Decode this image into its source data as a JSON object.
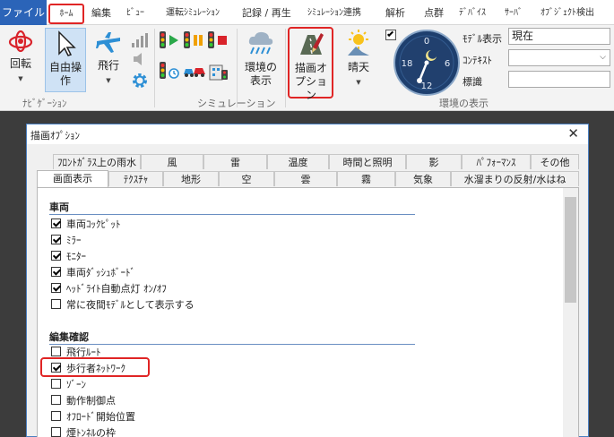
{
  "tabs": {
    "file": "ファイル",
    "home": "ﾎｰﾑ",
    "edit": "編集",
    "view": "ﾋﾞｭｰ",
    "driving_sim": "運転ｼﾐｭﾚｰｼｮﾝ",
    "record_play": "記録 / 再生",
    "sim_link": "ｼﾐｭﾚｰｼｮﾝ連携",
    "analysis": "解析",
    "point_cloud": "点群",
    "device": "ﾃﾞﾊﾞｲｽ",
    "server": "ｻｰﾊﾞ",
    "object_detect": "ｵﾌﾞｼﾞｪｸﾄ検出"
  },
  "ribbon": {
    "rotate": "回転",
    "free_op_1": "自由操",
    "free_op_2": "作",
    "fly": "飛行",
    "env_display_1": "環境の",
    "env_display_2": "表示",
    "draw_opt_1": "描画オ",
    "draw_opt_2": "プション",
    "fine": "晴天",
    "group_nav": "ﾅﾋﾞｹﾞｰｼｮﾝ",
    "group_sim": "シミュレーション",
    "group_env": "環境の表示",
    "model_display_label": "ﾓﾃﾞﾙ表示",
    "model_display_value": "現在",
    "context_label": "ｺﾝﾃｷｽﾄ",
    "context_value": "",
    "sign_label": "標識",
    "sign_value": ""
  },
  "clock": {
    "numbers": [
      "0",
      "6",
      "12",
      "18"
    ]
  },
  "dialog": {
    "title": "描画ｵﾌﾟｼｮﾝ",
    "close": "✕",
    "tabs_row1": [
      "ﾌﾛﾝﾄｶﾞﾗｽ上の雨水",
      "風",
      "雷",
      "温度",
      "時間と照明",
      "影",
      "ﾊﾟﾌｫｰﾏﾝｽ",
      "その他"
    ],
    "tabs_row2": [
      "画面表示",
      "ﾃｸｽﾁｬ",
      "地形",
      "空",
      "雲",
      "霧",
      "気象",
      "水溜まりの反射/水はね"
    ],
    "section_vehicle": "車両",
    "vehicle_items": [
      {
        "label": "車両ｺｯｸﾋﾟｯﾄ",
        "checked": true
      },
      {
        "label": "ﾐﾗｰ",
        "checked": true
      },
      {
        "label": "ﾓﾆﾀｰ",
        "checked": true
      },
      {
        "label": "車両ﾀﾞｯｼｭﾎﾞｰﾄﾞ",
        "checked": true
      },
      {
        "label": "ﾍｯﾄﾞﾗｲﾄ自動点灯 ｵﾝ/ｵﾌ",
        "checked": true
      },
      {
        "label": "常に夜間ﾓﾃﾞﾙとして表示する",
        "checked": false
      }
    ],
    "section_edit": "編集確認",
    "edit_items": [
      {
        "label": "飛行ﾙｰﾄ",
        "checked": false
      },
      {
        "label": "歩行者ﾈｯﾄﾜｰｸ",
        "checked": true
      },
      {
        "label": "ｿﾞｰﾝ",
        "checked": false
      },
      {
        "label": "動作制御点",
        "checked": false
      },
      {
        "label": "ｵﾌﾛｰﾄﾞ開始位置",
        "checked": false
      },
      {
        "label": "煙ﾄﾝﾈﾙの枠",
        "checked": false
      }
    ]
  }
}
